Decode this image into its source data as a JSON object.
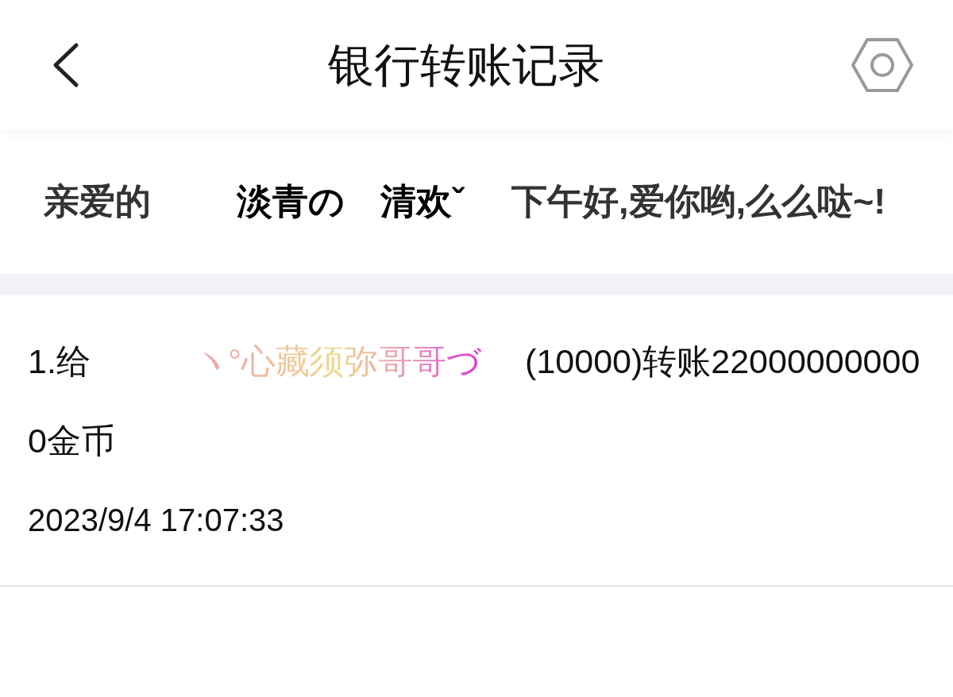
{
  "header": {
    "title": "银行转账记录"
  },
  "greeting": {
    "prefix": "亲爱的",
    "name": "淡青の　清欢ˇ",
    "suffix": "下午好,爱你哟,么么哒~!"
  },
  "records": [
    {
      "prefix": "1.给",
      "name": "ヽ°心藏须弥哥哥づ",
      "amount": "(10000)转账220000000000金币",
      "time": "2023/9/4 17:07:33"
    }
  ]
}
